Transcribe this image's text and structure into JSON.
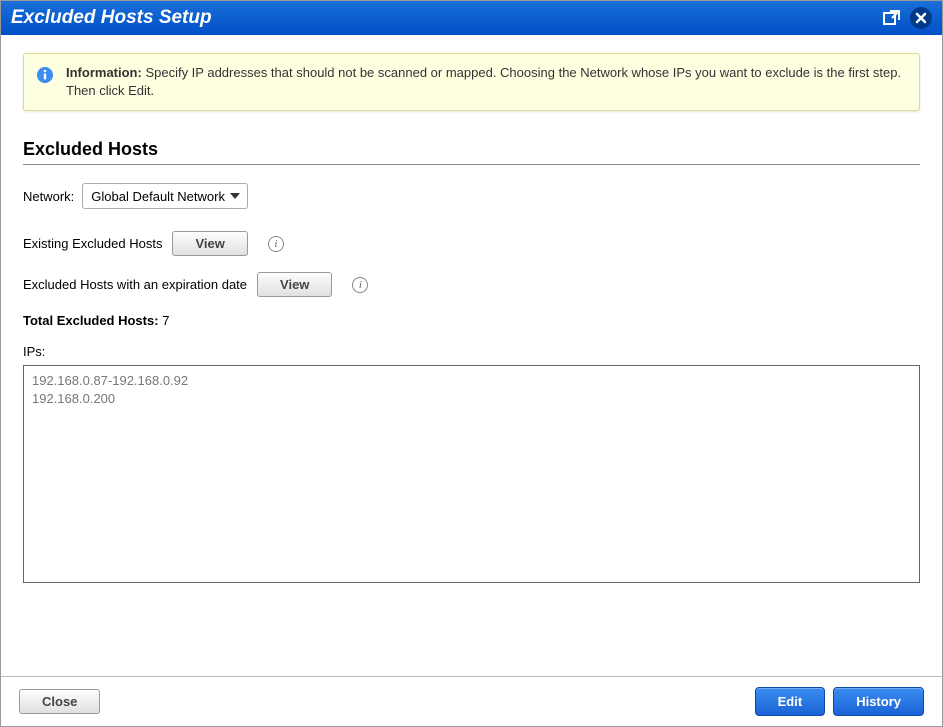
{
  "titlebar": {
    "title": "Excluded Hosts Setup"
  },
  "infobox": {
    "label": "Information:",
    "text": " Specify IP addresses that should not be scanned or mapped. Choosing the Network whose IPs you want to exclude is the first step. Then click Edit."
  },
  "section": {
    "heading": "Excluded Hosts"
  },
  "network": {
    "label": "Network:",
    "selected": "Global Default Network",
    "options": [
      "Global Default Network"
    ]
  },
  "existing": {
    "label": "Existing Excluded Hosts",
    "button": "View"
  },
  "expiration": {
    "label": "Excluded Hosts with an expiration date",
    "button": "View"
  },
  "total": {
    "label": "Total Excluded Hosts:",
    "value": "7"
  },
  "ips": {
    "label": "IPs:",
    "value": "192.168.0.87-192.168.0.92\n192.168.0.200"
  },
  "footer": {
    "close": "Close",
    "edit": "Edit",
    "history": "History"
  }
}
